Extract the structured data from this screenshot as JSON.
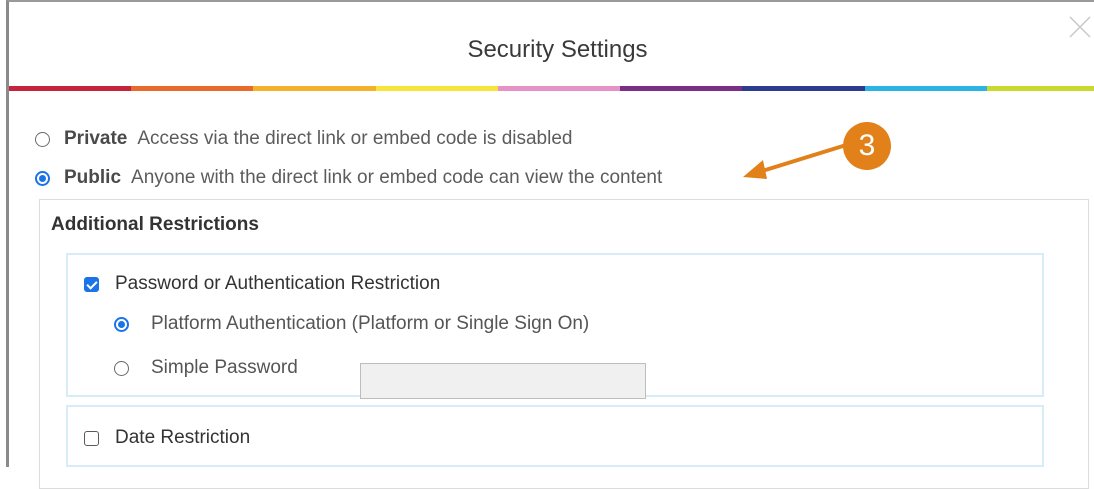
{
  "dialog": {
    "title": "Security Settings",
    "close_icon": "close-icon"
  },
  "stripe_colors": [
    "#c4243c",
    "#e86a2c",
    "#f2b32a",
    "#f6e43a",
    "#e493c4",
    "#7b2e86",
    "#2c3b8c",
    "#2bb3e6",
    "#c9d92e"
  ],
  "visibility": {
    "private": {
      "label": "Private",
      "description": "Access via the direct link or embed code is disabled",
      "selected": false
    },
    "public": {
      "label": "Public",
      "description": "Anyone with the direct link or embed code can view the content",
      "selected": true
    }
  },
  "restrictions": {
    "title": "Additional Restrictions",
    "password": {
      "label": "Password or Authentication Restriction",
      "checked": true,
      "options": {
        "platform": {
          "label": "Platform Authentication (Platform or Single Sign On)",
          "selected": true
        },
        "simple": {
          "label": "Simple Password",
          "selected": false,
          "value": ""
        }
      }
    },
    "date": {
      "label": "Date Restriction",
      "checked": false
    }
  },
  "annotation": {
    "step_number": "3",
    "color": "#e2801a"
  }
}
